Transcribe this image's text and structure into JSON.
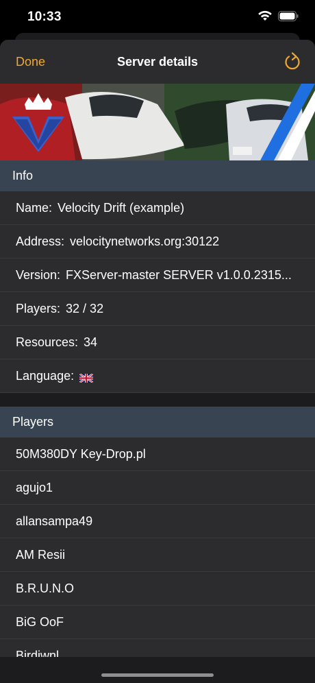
{
  "status": {
    "time": "10:33"
  },
  "nav": {
    "done_label": "Done",
    "title": "Server details"
  },
  "info": {
    "header": "Info",
    "rows": [
      {
        "label": "Name:",
        "value": "Velocity Drift (example)"
      },
      {
        "label": "Address:",
        "value": "velocitynetworks.org:30122"
      },
      {
        "label": "Version:",
        "value": "FXServer-master SERVER v1.0.0.2315..."
      },
      {
        "label": "Players:",
        "value": "32 / 32"
      },
      {
        "label": "Resources:",
        "value": "34"
      },
      {
        "label": "Language:",
        "value": ""
      }
    ]
  },
  "players": {
    "header": "Players",
    "items": [
      "50M380DY Key-Drop.pl",
      "agujo1",
      "allansampa49",
      "AM Resii",
      "B.R.U.N.O",
      "BiG OoF",
      "Birdiwnl"
    ]
  },
  "colors": {
    "accent": "#f0a830",
    "section_header": "#394452",
    "sheet": "#2c2c2e"
  },
  "icons": {
    "refresh": "refresh-icon",
    "flag": "uk-flag-icon",
    "wifi": "wifi-icon",
    "battery": "battery-icon"
  }
}
